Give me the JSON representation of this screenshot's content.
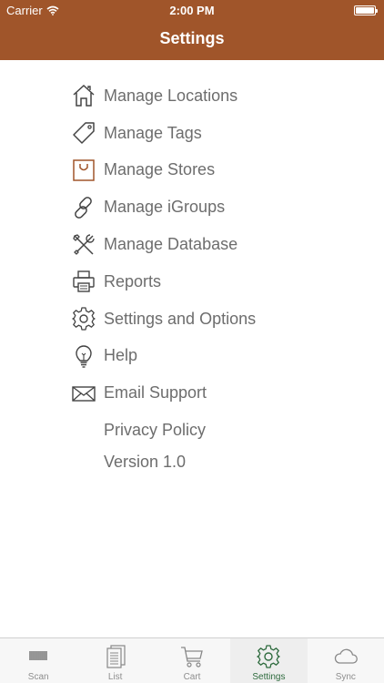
{
  "status_bar": {
    "carrier": "Carrier",
    "time": "2:00 PM"
  },
  "nav": {
    "title": "Settings"
  },
  "colors": {
    "brand": "#a0552a",
    "tab_active": "#2e6b3e",
    "text": "#6d6d6d"
  },
  "menu": {
    "items": [
      {
        "label": "Manage Locations",
        "icon": "house-icon"
      },
      {
        "label": "Manage Tags",
        "icon": "tag-icon"
      },
      {
        "label": "Manage Stores",
        "icon": "shopping-bag-icon"
      },
      {
        "label": "Manage iGroups",
        "icon": "link-icon"
      },
      {
        "label": "Manage Database",
        "icon": "tools-icon"
      },
      {
        "label": "Reports",
        "icon": "printer-icon"
      },
      {
        "label": "Settings and Options",
        "icon": "gear-icon"
      },
      {
        "label": "Help",
        "icon": "lightbulb-icon"
      },
      {
        "label": "Email Support",
        "icon": "envelope-icon"
      }
    ],
    "privacy_label": "Privacy Policy",
    "version_label": "Version 1.0"
  },
  "tabs": [
    {
      "label": "Scan",
      "icon": "barcode-icon"
    },
    {
      "label": "List",
      "icon": "list-icon"
    },
    {
      "label": "Cart",
      "icon": "cart-icon"
    },
    {
      "label": "Settings",
      "icon": "gear-icon",
      "active": true
    },
    {
      "label": "Sync",
      "icon": "cloud-icon"
    }
  ]
}
